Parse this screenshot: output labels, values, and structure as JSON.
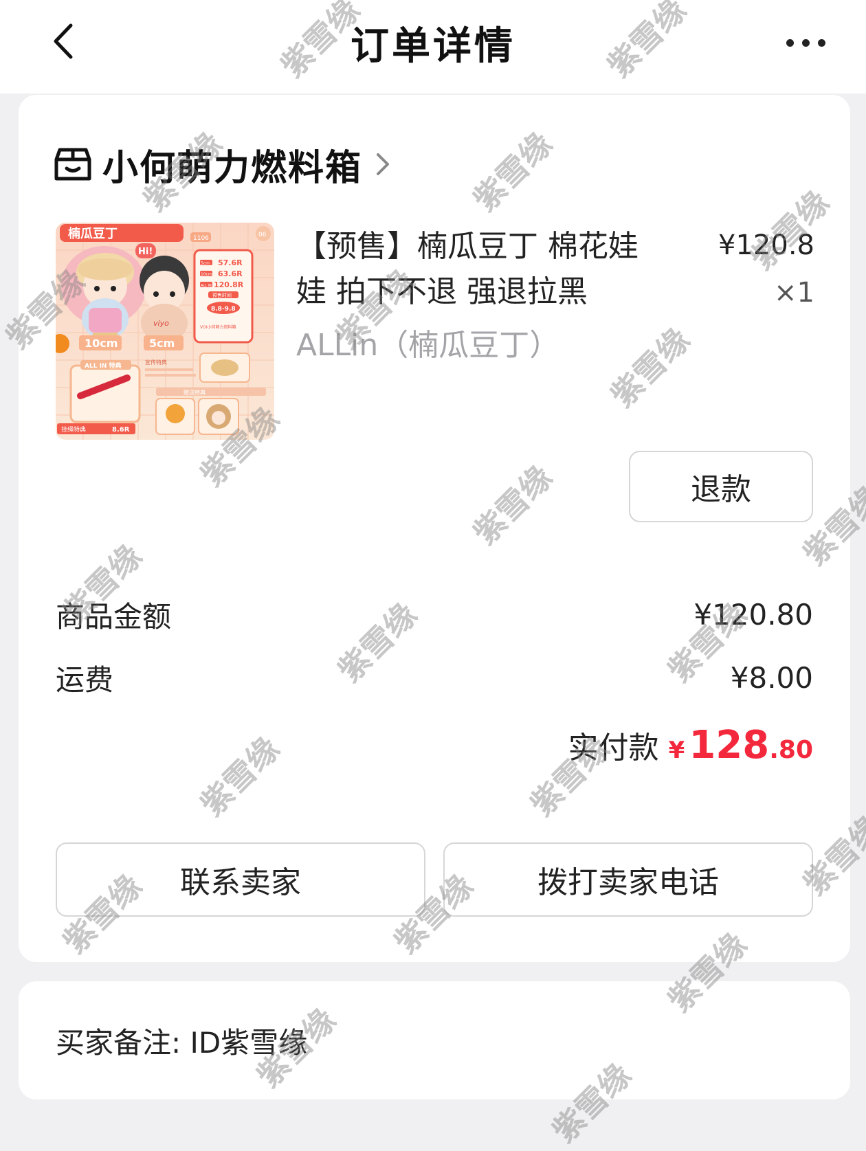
{
  "header": {
    "title": "订单详情"
  },
  "shop": {
    "name": "小何萌力燃料箱"
  },
  "product": {
    "title": "【预售】楠瓜豆丁 棉花娃娃 拍下不退 强退拉黑",
    "variant": "ALLin（楠瓜豆丁）",
    "price": "¥120.8",
    "quantity": "×1",
    "thumbnail": {
      "banner": "楠瓜豆丁",
      "hi": "Hi!",
      "code": "1106",
      "corner": "06",
      "prices": [
        "57.6R",
        "63.6R",
        "120.8R"
      ],
      "price_tags": [
        "5cm",
        "10cm",
        "ALL IN"
      ],
      "presale_label": "预售时间",
      "presale_date": "8.8-9.8",
      "shop_label": "VOI小何萌力燃料箱",
      "sizes": [
        "10cm",
        "5cm"
      ],
      "allin_tag": "ALL IN 特典",
      "doll_text": "viyo",
      "perk_label": "宣传特典",
      "lanyard_label": "挂绳特典",
      "lanyard_price": "8.6R",
      "bonus_label": "赠送特典"
    }
  },
  "actions": {
    "refund": "退款",
    "contact_seller": "联系卖家",
    "call_seller": "拨打卖家电话"
  },
  "summary": {
    "goods_label": "商品金额",
    "goods_value": "¥120.80",
    "shipping_label": "运费",
    "shipping_value": "¥8.00",
    "paid_label": "实付款",
    "paid_currency": "¥",
    "paid_integer": "128",
    "paid_decimal": ".80"
  },
  "note": {
    "text": "买家备注: ID紫雪缘"
  },
  "watermark": {
    "text": "紫雪缘"
  },
  "colors": {
    "accent_red": "#f4283c",
    "background": "#f0f0f2",
    "card": "#ffffff",
    "muted_text": "#a4a4a8"
  },
  "icons": {
    "back": "chevron-left-icon",
    "more": "more-dots-icon",
    "shop": "store-icon",
    "shop_arrow": "chevron-right-icon"
  }
}
